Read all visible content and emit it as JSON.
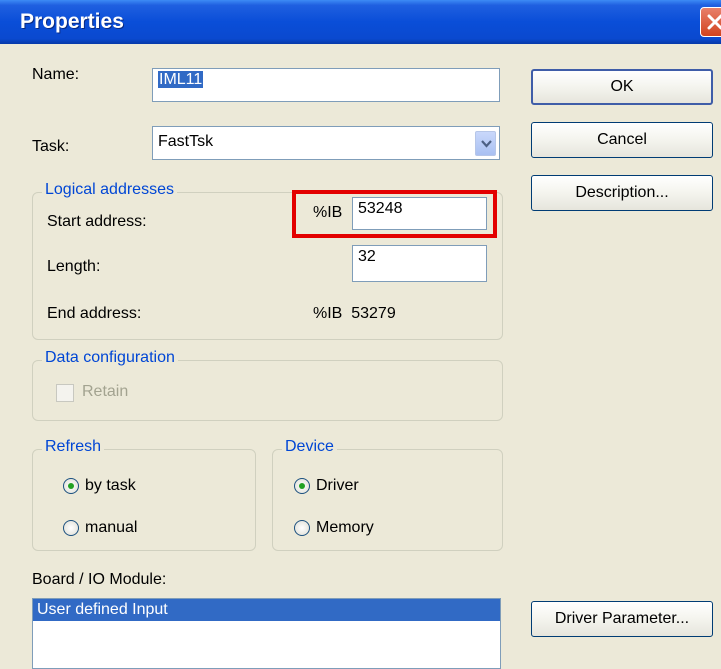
{
  "window": {
    "title": "Properties"
  },
  "fields": {
    "name_label": "Name:",
    "name_value": "IML11",
    "task_label": "Task:",
    "task_value": "FastTsk"
  },
  "buttons": {
    "ok": "OK",
    "cancel": "Cancel",
    "description": "Description...",
    "driver_parameter": "Driver Parameter..."
  },
  "logical_addresses": {
    "title": "Logical addresses",
    "start_label": "Start address:",
    "start_prefix": "%IB",
    "start_value": "53248",
    "length_label": "Length:",
    "length_value": "32",
    "end_label": "End address:",
    "end_value": "%IB  53279"
  },
  "data_configuration": {
    "title": "Data configuration",
    "retain_label": "Retain"
  },
  "refresh": {
    "title": "Refresh",
    "options": [
      "by task",
      "manual"
    ],
    "selected": "by task"
  },
  "device": {
    "title": "Device",
    "options": [
      "Driver",
      "Memory"
    ],
    "selected": "Driver"
  },
  "board": {
    "label": "Board / IO Module:",
    "items": [
      "User defined Input"
    ]
  },
  "colors": {
    "highlight": "#e30000",
    "group_title": "#0046d5",
    "selection": "#316ac5"
  }
}
